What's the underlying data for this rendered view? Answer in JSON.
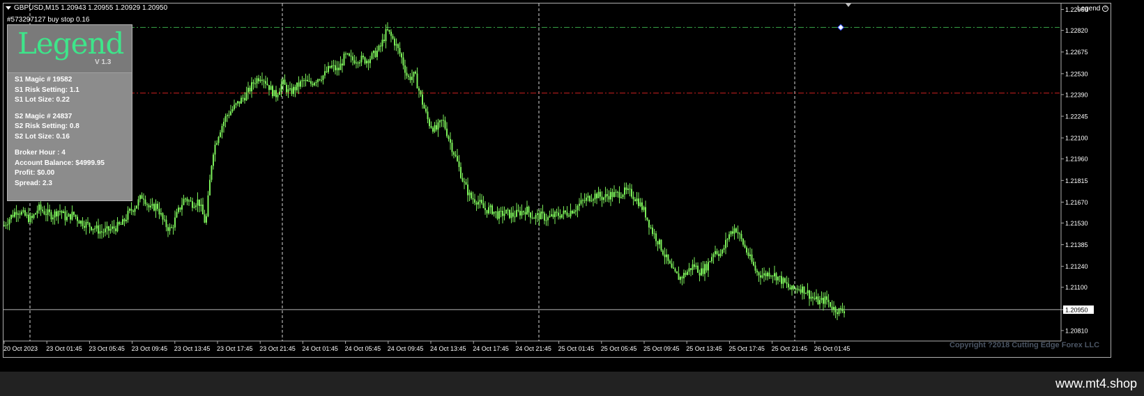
{
  "header": {
    "symbol_info": "GBPUSD,M15  1.20943 1.20955 1.20929 1.20950"
  },
  "order_label": "#573297127 buy stop 0.16",
  "legend_button": {
    "label": "Legend"
  },
  "panel": {
    "title": "Legend",
    "version": "V 1.3",
    "s1_magic": "S1 Magic # 19582",
    "s1_risk": "S1 Risk Setting: 1.1",
    "s1_lot": "S1 Lot Size: 0.22",
    "s2_magic": "S2 Magic # 24837",
    "s2_risk": "S2 Risk Setting: 0.8",
    "s2_lot": "S2 Lot Size: 0.16",
    "broker_hour": "Broker Hour : 4",
    "account_balance": "Account Balance: $4999.95",
    "profit": "Profit: $0.00",
    "spread": "Spread:  2.3"
  },
  "copyright": "Copyright ?2018 Cutting Edge Forex LLC",
  "watermark": "www.mt4.shop",
  "colors": {
    "candle": "#7cf05a",
    "buy_stop_line": "#3aa84a",
    "stop_line": "#d02020",
    "grid": "#d8d8d8"
  },
  "chart_data": {
    "type": "candlestick",
    "ylim": [
      1.2074,
      1.23
    ],
    "current_price": "1.20950",
    "current_price_value": 1.2095,
    "buy_stop_price": 1.2284,
    "stop_price": 1.224,
    "y_ticks": [
      "1.22960",
      "1.22820",
      "1.22675",
      "1.22530",
      "1.22390",
      "1.22245",
      "1.22100",
      "1.21960",
      "1.21815",
      "1.21670",
      "1.21530",
      "1.21385",
      "1.21240",
      "1.21100",
      "1.20950",
      "1.20810"
    ],
    "y_tick_values": [
      1.2296,
      1.2282,
      1.22675,
      1.2253,
      1.2239,
      1.22245,
      1.221,
      1.2196,
      1.21815,
      1.2167,
      1.2153,
      1.21385,
      1.2124,
      1.211,
      1.2095,
      1.2081
    ],
    "x_ticks": [
      "20 Oct 2023",
      "23 Oct 01:45",
      "23 Oct 05:45",
      "23 Oct 09:45",
      "23 Oct 13:45",
      "23 Oct 17:45",
      "23 Oct 21:45",
      "24 Oct 01:45",
      "24 Oct 05:45",
      "24 Oct 09:45",
      "24 Oct 13:45",
      "24 Oct 17:45",
      "24 Oct 21:45",
      "25 Oct 01:45",
      "25 Oct 05:45",
      "25 Oct 09:45",
      "25 Oct 13:45",
      "25 Oct 17:45",
      "25 Oct 21:45",
      "26 Oct 01:45"
    ],
    "close_path": [
      [
        0,
        1.2151
      ],
      [
        10,
        1.2157
      ],
      [
        20,
        1.2162
      ],
      [
        30,
        1.2158
      ],
      [
        40,
        1.2155
      ],
      [
        50,
        1.2163
      ],
      [
        60,
        1.216
      ],
      [
        70,
        1.2158
      ],
      [
        80,
        1.2162
      ],
      [
        90,
        1.2156
      ],
      [
        100,
        1.2159
      ],
      [
        110,
        1.2154
      ],
      [
        120,
        1.2152
      ],
      [
        130,
        1.215
      ],
      [
        140,
        1.2147
      ],
      [
        150,
        1.2148
      ],
      [
        160,
        1.215
      ],
      [
        170,
        1.2152
      ],
      [
        180,
        1.216
      ],
      [
        190,
        1.2165
      ],
      [
        200,
        1.2172
      ],
      [
        210,
        1.2162
      ],
      [
        220,
        1.2165
      ],
      [
        230,
        1.2153
      ],
      [
        240,
        1.2148
      ],
      [
        250,
        1.216
      ],
      [
        260,
        1.217
      ],
      [
        270,
        1.2166
      ],
      [
        280,
        1.2168
      ],
      [
        290,
        1.2152
      ],
      [
        300,
        1.22
      ],
      [
        310,
        1.2215
      ],
      [
        320,
        1.2225
      ],
      [
        330,
        1.223
      ],
      [
        340,
        1.2235
      ],
      [
        350,
        1.224
      ],
      [
        360,
        1.2248
      ],
      [
        370,
        1.2252
      ],
      [
        380,
        1.2245
      ],
      [
        390,
        1.2238
      ],
      [
        400,
        1.2247
      ],
      [
        410,
        1.224
      ],
      [
        420,
        1.2244
      ],
      [
        430,
        1.2248
      ],
      [
        440,
        1.2246
      ],
      [
        450,
        1.225
      ],
      [
        460,
        1.2252
      ],
      [
        470,
        1.2258
      ],
      [
        480,
        1.2255
      ],
      [
        490,
        1.2265
      ],
      [
        500,
        1.2262
      ],
      [
        510,
        1.2263
      ],
      [
        520,
        1.2262
      ],
      [
        530,
        1.2265
      ],
      [
        540,
        1.227
      ],
      [
        550,
        1.2282
      ],
      [
        560,
        1.2275
      ],
      [
        570,
        1.2265
      ],
      [
        580,
        1.225
      ],
      [
        590,
        1.2252
      ],
      [
        600,
        1.2235
      ],
      [
        610,
        1.222
      ],
      [
        620,
        1.2215
      ],
      [
        630,
        1.2222
      ],
      [
        640,
        1.2208
      ],
      [
        650,
        1.2195
      ],
      [
        660,
        1.218
      ],
      [
        670,
        1.217
      ],
      [
        680,
        1.2168
      ],
      [
        690,
        1.2162
      ],
      [
        700,
        1.2162
      ],
      [
        710,
        1.2158
      ],
      [
        720,
        1.216
      ],
      [
        730,
        1.2158
      ],
      [
        740,
        1.216
      ],
      [
        750,
        1.2162
      ],
      [
        760,
        1.2157
      ],
      [
        770,
        1.2158
      ],
      [
        780,
        1.2156
      ],
      [
        790,
        1.2158
      ],
      [
        800,
        1.2159
      ],
      [
        810,
        1.216
      ],
      [
        820,
        1.2163
      ],
      [
        830,
        1.2167
      ],
      [
        840,
        1.217
      ],
      [
        850,
        1.2172
      ],
      [
        860,
        1.217
      ],
      [
        870,
        1.2172
      ],
      [
        880,
        1.2172
      ],
      [
        890,
        1.2174
      ],
      [
        900,
        1.2173
      ],
      [
        910,
        1.2168
      ],
      [
        920,
        1.216
      ],
      [
        930,
        1.2148
      ],
      [
        940,
        1.214
      ],
      [
        950,
        1.213
      ],
      [
        960,
        1.212
      ],
      [
        970,
        1.2116
      ],
      [
        980,
        1.212
      ],
      [
        990,
        1.2125
      ],
      [
        1000,
        1.212
      ],
      [
        1010,
        1.2125
      ],
      [
        1020,
        1.2135
      ],
      [
        1030,
        1.2132
      ],
      [
        1040,
        1.2145
      ],
      [
        1050,
        1.215
      ],
      [
        1060,
        1.214
      ],
      [
        1070,
        1.213
      ],
      [
        1080,
        1.212
      ],
      [
        1090,
        1.2118
      ],
      [
        1100,
        1.212
      ],
      [
        1110,
        1.2117
      ],
      [
        1120,
        1.2113
      ],
      [
        1130,
        1.2108
      ],
      [
        1140,
        1.211
      ],
      [
        1150,
        1.2108
      ],
      [
        1160,
        1.2103
      ],
      [
        1170,
        1.21
      ],
      [
        1180,
        1.2102
      ],
      [
        1190,
        1.2096
      ],
      [
        1200,
        1.2094
      ],
      [
        1207,
        1.2095
      ]
    ]
  }
}
